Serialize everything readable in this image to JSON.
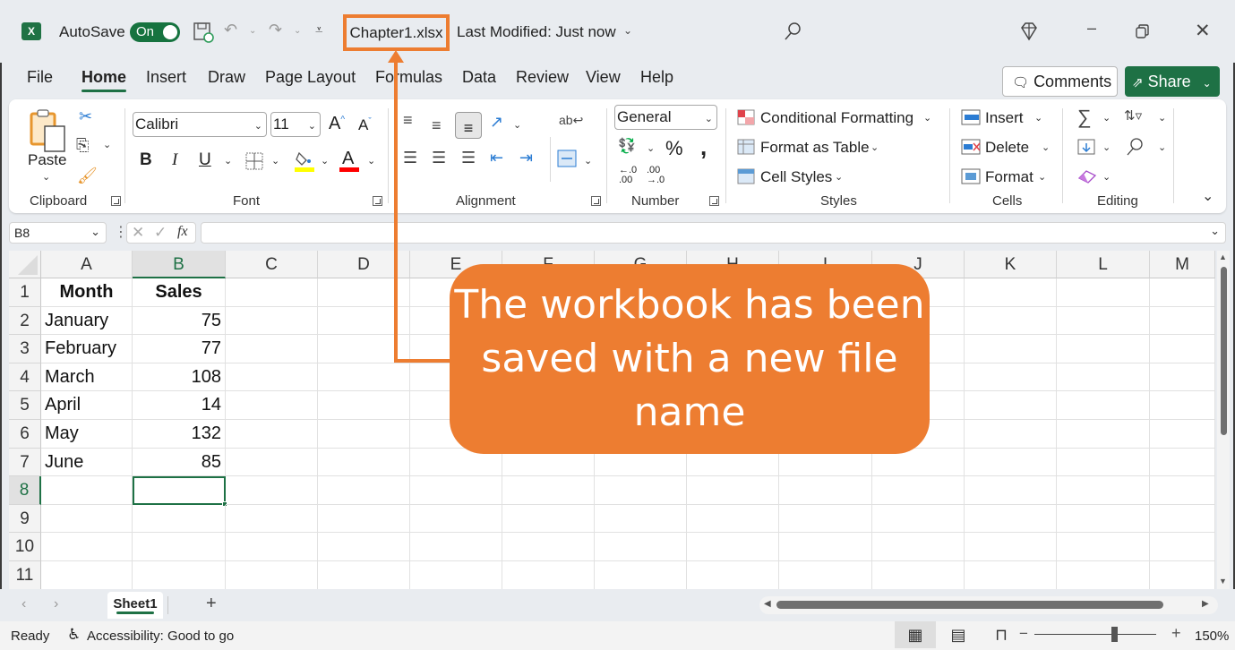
{
  "titlebar": {
    "app_icon": "excel-logo-icon",
    "autosave_label": "AutoSave",
    "autosave_state": "On",
    "filename": "Chapter1.xlsx",
    "last_modified": "Last Modified: Just now",
    "icons": [
      "save-icon",
      "undo-icon",
      "redo-icon",
      "customize-toolbar-icon",
      "search-icon",
      "premium-diamond-icon",
      "minimize-icon",
      "restore-icon",
      "close-icon"
    ]
  },
  "tabs": [
    {
      "label": "File"
    },
    {
      "label": "Home",
      "active": true
    },
    {
      "label": "Insert"
    },
    {
      "label": "Draw"
    },
    {
      "label": "Page Layout"
    },
    {
      "label": "Formulas"
    },
    {
      "label": "Data"
    },
    {
      "label": "Review"
    },
    {
      "label": "View"
    },
    {
      "label": "Help"
    }
  ],
  "header_buttons": {
    "comments": "Comments",
    "share": "Share"
  },
  "ribbon": {
    "clipboard": {
      "label": "Clipboard",
      "paste": "Paste"
    },
    "font": {
      "label": "Font",
      "font_name": "Calibri",
      "font_size": "11",
      "bold": "B",
      "italic": "I",
      "underline": "U",
      "fill_color": "#ffff00",
      "font_color": "#ff0000"
    },
    "alignment": {
      "label": "Alignment"
    },
    "number": {
      "label": "Number",
      "format": "General",
      "percent": "%",
      "comma": ",",
      "increase_decimal": "←.0 .00",
      "decrease_decimal": ".00 →.0"
    },
    "styles": {
      "label": "Styles",
      "conditional_formatting": "Conditional Formatting",
      "format_as_table": "Format as Table",
      "cell_styles": "Cell Styles"
    },
    "cells": {
      "label": "Cells",
      "insert": "Insert",
      "delete": "Delete",
      "format": "Format"
    },
    "editing": {
      "label": "Editing"
    }
  },
  "formula_bar": {
    "name_box": "B8",
    "formula": ""
  },
  "sheet": {
    "columns": [
      "A",
      "B",
      "C",
      "D",
      "E",
      "F",
      "G",
      "H",
      "I",
      "J",
      "K",
      "L",
      "M"
    ],
    "selected_column": "B",
    "selected_row": "8",
    "rows": [
      {
        "num": "1",
        "a": "Month",
        "b": "Sales"
      },
      {
        "num": "2",
        "a": "January",
        "b": "75"
      },
      {
        "num": "3",
        "a": "February",
        "b": "77"
      },
      {
        "num": "4",
        "a": "March",
        "b": "108"
      },
      {
        "num": "5",
        "a": "April",
        "b": "14"
      },
      {
        "num": "6",
        "a": "May",
        "b": "132"
      },
      {
        "num": "7",
        "a": "June",
        "b": "85"
      },
      {
        "num": "8",
        "a": "",
        "b": ""
      },
      {
        "num": "9",
        "a": "",
        "b": ""
      },
      {
        "num": "10",
        "a": "",
        "b": ""
      },
      {
        "num": "11",
        "a": "",
        "b": ""
      }
    ]
  },
  "sheet_tabs": {
    "active": "Sheet1",
    "add": "+"
  },
  "statusbar": {
    "ready": "Ready",
    "accessibility": "Accessibility: Good to go",
    "zoom_level": "150%",
    "zoom_minus": "−",
    "zoom_plus": "+"
  },
  "callout": {
    "text": "The workbook has been saved with a new file name",
    "color": "#ed7d31"
  }
}
